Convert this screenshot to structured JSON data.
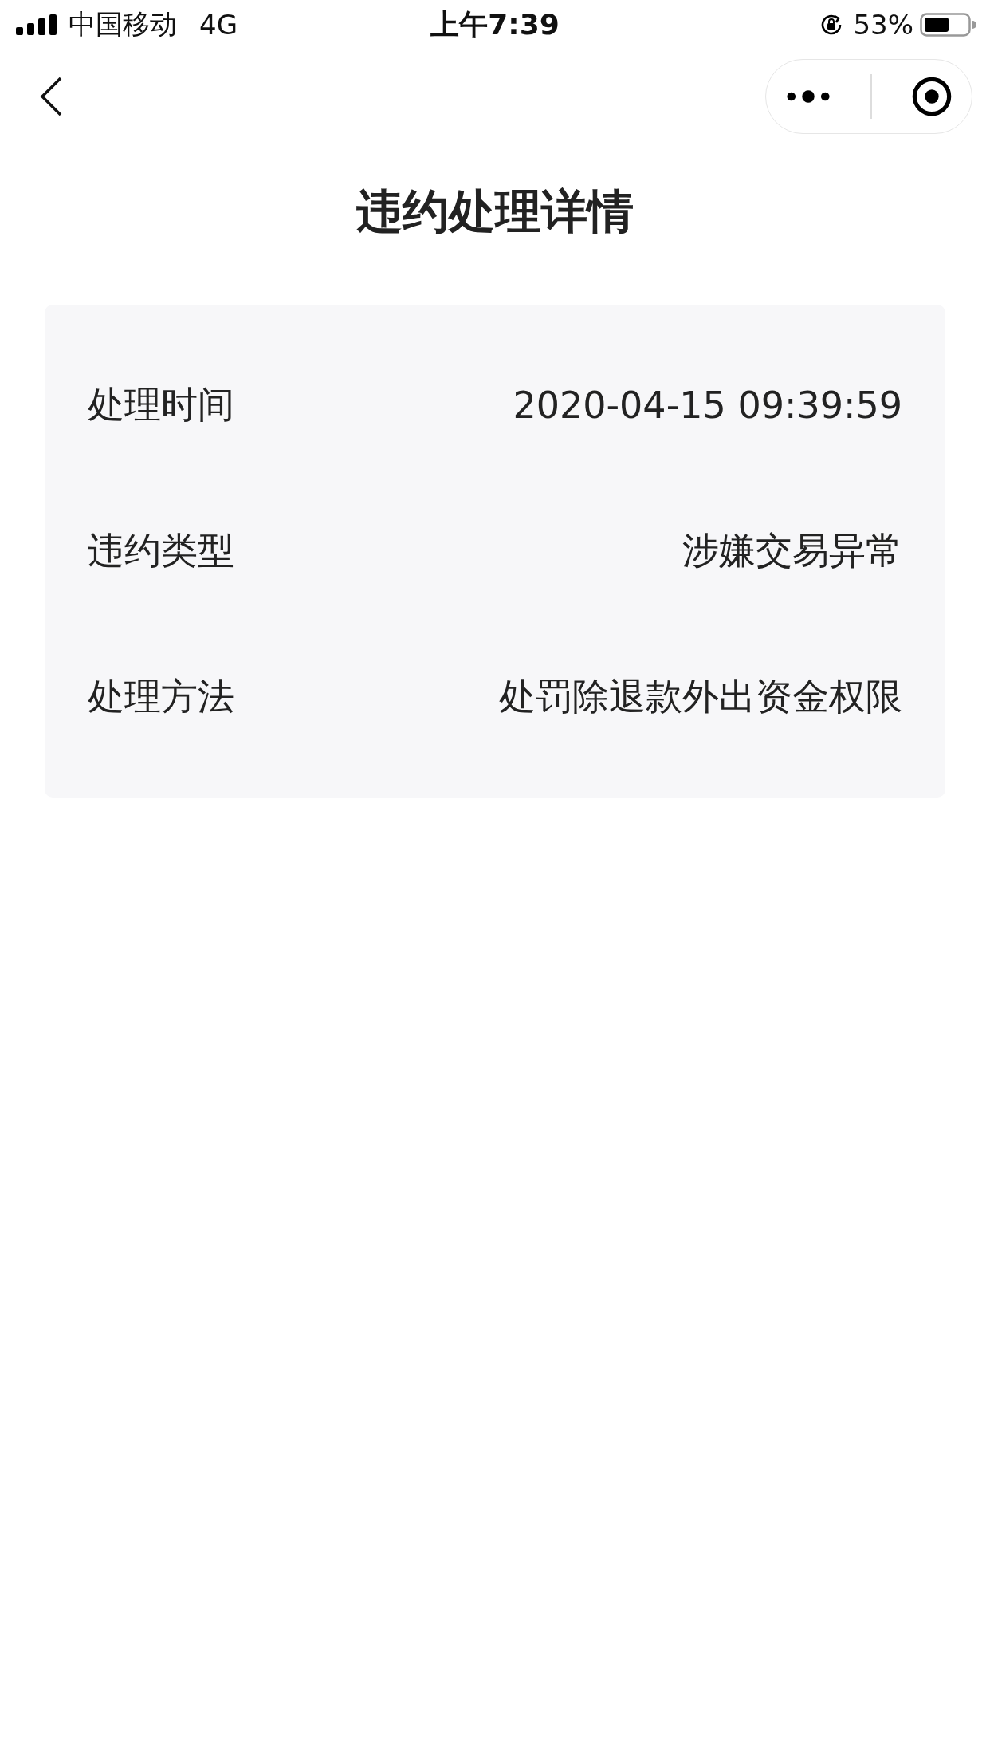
{
  "status_bar": {
    "carrier": "中国移动",
    "network": "4G",
    "time": "上午7:39",
    "battery": "53%"
  },
  "page": {
    "title": "违约处理详情"
  },
  "details": [
    {
      "label": "处理时间",
      "value": "2020-04-15 09:39:59"
    },
    {
      "label": "违约类型",
      "value": "涉嫌交易异常"
    },
    {
      "label": "处理方法",
      "value": "处罚除退款外出资金权限"
    }
  ]
}
